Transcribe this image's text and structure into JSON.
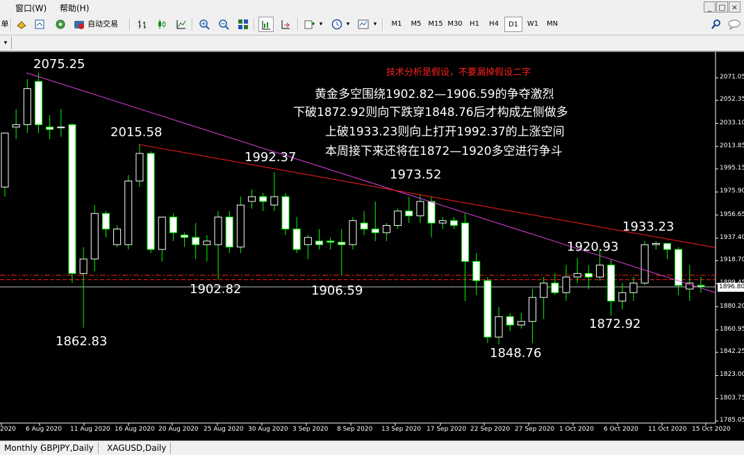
{
  "menu": {
    "items": [
      "窗口(W)",
      "帮助(H)"
    ],
    "partial_left": "",
    "window_buttons": [
      "_",
      "□",
      "×"
    ]
  },
  "toolbar": {
    "left_label": "单",
    "auto_trade_label": "自动交易",
    "timeframes": [
      "M1",
      "M5",
      "M15",
      "M30",
      "H1",
      "H4",
      "D1",
      "W1",
      "MN"
    ],
    "active_timeframe": "D1",
    "dropdown_arrow": "▾"
  },
  "chart": {
    "current_price": "1896.80",
    "price_axis": [
      "2071.05",
      "2052.35",
      "2033.10",
      "2013.85",
      "1995.15",
      "1975.90",
      "1956.65",
      "1937.40",
      "1918.70",
      "1899.45",
      "1880.20",
      "1860.95",
      "1842.25",
      "1823.00",
      "1803.75",
      "1785.05"
    ],
    "date_axis": [
      "2020",
      "6 Aug 2020",
      "11 Aug 2020",
      "16 Aug 2020",
      "20 Aug 2020",
      "25 Aug 2020",
      "30 Aug 2020",
      "3 Sep 2020",
      "8 Sep 2020",
      "13 Sep 2020",
      "17 Sep 2020",
      "22 Sep 2020",
      "27 Sep 2020",
      "1 Oct 2020",
      "6 Oct 2020",
      "11 Oct 2020",
      "15 Oct 2020"
    ],
    "price_labels": [
      {
        "text": "2075.25"
      },
      {
        "text": "2015.58"
      },
      {
        "text": "1992.37"
      },
      {
        "text": "1973.52"
      },
      {
        "text": "1920.93"
      },
      {
        "text": "1933.23"
      },
      {
        "text": "1902.82"
      },
      {
        "text": "1906.59"
      },
      {
        "text": "1862.83"
      },
      {
        "text": "1848.76"
      },
      {
        "text": "1872.92"
      }
    ],
    "annotation_red": "技术分析是假设，不要漏掉假设二字",
    "annotation_lines": [
      "黄金多空围绕1902.82—1906.59的争夺激烈",
      "下破1872.92则向下跌穿1848.76后才构成左侧做多",
      "上破1933.23则向上打开1992.37的上涨空间",
      "本周接下来还将在1872—1920多空进行争斗"
    ],
    "colors": {
      "background": "#000000",
      "bull": "#ffffff",
      "bear": "#ffffff",
      "wick": "#00ff00",
      "trend_magenta": "#e040e0",
      "trend_red": "#ff2020",
      "level_red": "#ff2020"
    }
  },
  "chart_data": {
    "type": "candlestick",
    "ylim": [
      1785.05,
      2071.05
    ],
    "candles": [
      {
        "o": 1980,
        "h": 2010,
        "l": 1972,
        "c": 2025
      },
      {
        "o": 2030,
        "h": 2045,
        "l": 2020,
        "c": 2032
      },
      {
        "o": 2032,
        "h": 2070,
        "l": 2025,
        "c": 2062
      },
      {
        "o": 2068,
        "h": 2075.25,
        "l": 2025,
        "c": 2032
      },
      {
        "o": 2030,
        "h": 2040,
        "l": 2020,
        "c": 2028
      },
      {
        "o": 2030,
        "h": 2045,
        "l": 2022,
        "c": 2030
      },
      {
        "o": 2032,
        "h": 2033,
        "l": 1900,
        "c": 1908
      },
      {
        "o": 1908,
        "h": 1930,
        "l": 1862.83,
        "c": 1920
      },
      {
        "o": 1920,
        "h": 1965,
        "l": 1910,
        "c": 1958
      },
      {
        "o": 1958,
        "h": 1960,
        "l": 1938,
        "c": 1945
      },
      {
        "o": 1932,
        "h": 1948,
        "l": 1930,
        "c": 1945
      },
      {
        "o": 1932,
        "h": 1990,
        "l": 1928,
        "c": 1985
      },
      {
        "o": 1985,
        "h": 2015.58,
        "l": 1980,
        "c": 2008
      },
      {
        "o": 2008,
        "h": 2010,
        "l": 1925,
        "c": 1928
      },
      {
        "o": 1928,
        "h": 1955,
        "l": 1918,
        "c": 1955
      },
      {
        "o": 1955,
        "h": 1958,
        "l": 1935,
        "c": 1942
      },
      {
        "o": 1940,
        "h": 1942,
        "l": 1930,
        "c": 1938
      },
      {
        "o": 1938,
        "h": 1950,
        "l": 1920,
        "c": 1932
      },
      {
        "o": 1932,
        "h": 1940,
        "l": 1918,
        "c": 1935
      },
      {
        "o": 1932,
        "h": 1960,
        "l": 1902.82,
        "c": 1955
      },
      {
        "o": 1955,
        "h": 1960,
        "l": 1925,
        "c": 1930
      },
      {
        "o": 1930,
        "h": 1972,
        "l": 1925,
        "c": 1965
      },
      {
        "o": 1968,
        "h": 1978,
        "l": 1962,
        "c": 1972
      },
      {
        "o": 1972,
        "h": 1975,
        "l": 1960,
        "c": 1968
      },
      {
        "o": 1965,
        "h": 1992.37,
        "l": 1960,
        "c": 1972
      },
      {
        "o": 1972,
        "h": 1975,
        "l": 1940,
        "c": 1945
      },
      {
        "o": 1945,
        "h": 1955,
        "l": 1925,
        "c": 1928
      },
      {
        "o": 1932,
        "h": 1940,
        "l": 1920,
        "c": 1938
      },
      {
        "o": 1935,
        "h": 1945,
        "l": 1928,
        "c": 1932
      },
      {
        "o": 1935,
        "h": 1938,
        "l": 1928,
        "c": 1934
      },
      {
        "o": 1934,
        "h": 1945,
        "l": 1906.59,
        "c": 1932
      },
      {
        "o": 1932,
        "h": 1955,
        "l": 1928,
        "c": 1952
      },
      {
        "o": 1950,
        "h": 1960,
        "l": 1940,
        "c": 1945
      },
      {
        "o": 1945,
        "h": 1968,
        "l": 1935,
        "c": 1942
      },
      {
        "o": 1942,
        "h": 1950,
        "l": 1935,
        "c": 1948
      },
      {
        "o": 1948,
        "h": 1962,
        "l": 1945,
        "c": 1960
      },
      {
        "o": 1960,
        "h": 1972,
        "l": 1950,
        "c": 1956
      },
      {
        "o": 1956,
        "h": 1973.52,
        "l": 1950,
        "c": 1968
      },
      {
        "o": 1968,
        "h": 1972,
        "l": 1938,
        "c": 1950
      },
      {
        "o": 1950,
        "h": 1955,
        "l": 1945,
        "c": 1952
      },
      {
        "o": 1952,
        "h": 1955,
        "l": 1945,
        "c": 1948
      },
      {
        "o": 1950,
        "h": 1958,
        "l": 1885,
        "c": 1918
      },
      {
        "o": 1918,
        "h": 1925,
        "l": 1890,
        "c": 1902
      },
      {
        "o": 1902,
        "h": 1905,
        "l": 1850,
        "c": 1855
      },
      {
        "o": 1855,
        "h": 1880,
        "l": 1848.76,
        "c": 1872
      },
      {
        "o": 1872,
        "h": 1875,
        "l": 1860,
        "c": 1865
      },
      {
        "o": 1865,
        "h": 1875,
        "l": 1862,
        "c": 1868
      },
      {
        "o": 1868,
        "h": 1895,
        "l": 1850,
        "c": 1888
      },
      {
        "o": 1888,
        "h": 1905,
        "l": 1870,
        "c": 1900
      },
      {
        "o": 1900,
        "h": 1908,
        "l": 1890,
        "c": 1892
      },
      {
        "o": 1892,
        "h": 1915,
        "l": 1885,
        "c": 1905
      },
      {
        "o": 1905,
        "h": 1920.93,
        "l": 1900,
        "c": 1908
      },
      {
        "o": 1908,
        "h": 1915,
        "l": 1895,
        "c": 1905
      },
      {
        "o": 1905,
        "h": 1928,
        "l": 1902,
        "c": 1915
      },
      {
        "o": 1915,
        "h": 1920,
        "l": 1872.92,
        "c": 1885
      },
      {
        "o": 1885,
        "h": 1900,
        "l": 1878,
        "c": 1892
      },
      {
        "o": 1892,
        "h": 1905,
        "l": 1885,
        "c": 1900
      },
      {
        "o": 1900,
        "h": 1935,
        "l": 1898,
        "c": 1932
      },
      {
        "o": 1932,
        "h": 1935,
        "l": 1928,
        "c": 1933
      },
      {
        "o": 1933,
        "h": 1933.23,
        "l": 1920,
        "c": 1928
      },
      {
        "o": 1928,
        "h": 1930,
        "l": 1890,
        "c": 1898
      },
      {
        "o": 1895,
        "h": 1915,
        "l": 1885,
        "c": 1900
      },
      {
        "o": 1898,
        "h": 1905,
        "l": 1892,
        "c": 1896.8
      }
    ]
  },
  "bottom_tabs": [
    "Monthly",
    "GBPJPY,Daily",
    "XAGUSD,Daily"
  ]
}
